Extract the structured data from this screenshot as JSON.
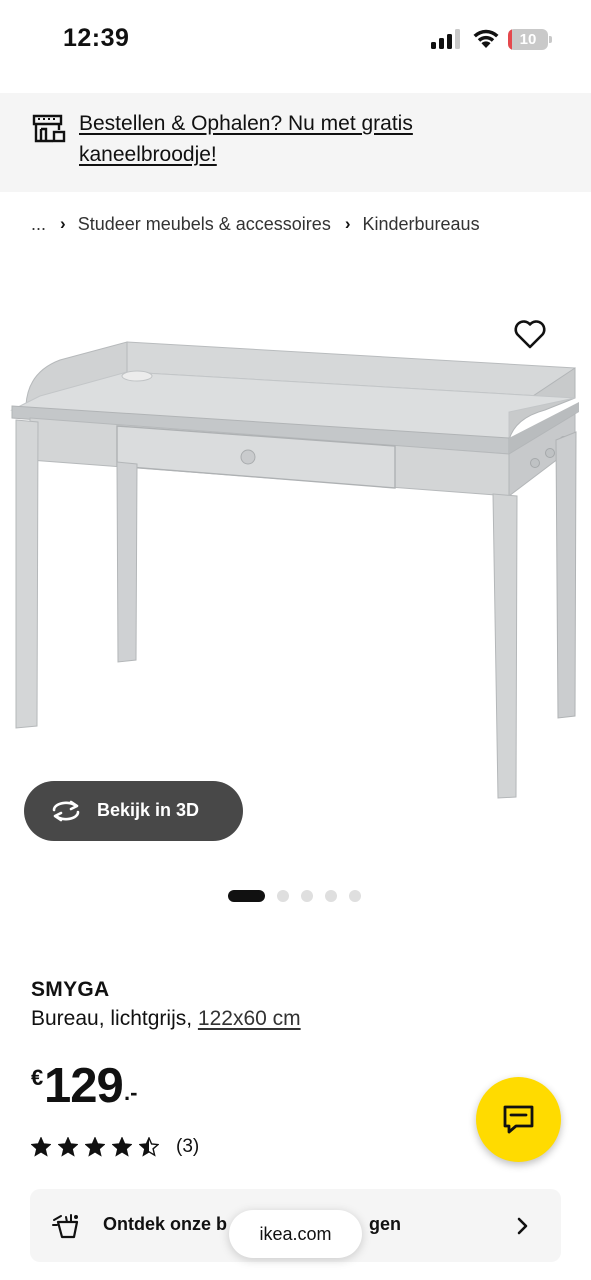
{
  "status_bar": {
    "time": "12:39",
    "battery_level": "10",
    "battery_fraction": 0.1,
    "icons": [
      "signal-icon",
      "wifi-icon",
      "battery-icon"
    ]
  },
  "promo_banner": {
    "icon": "store-icon",
    "text": "Bestellen & Ophalen? Nu met gratis kaneelbroodje!"
  },
  "breadcrumb": {
    "items": [
      "...",
      "Studeer meubels & accessoires",
      "Kinderbureaus"
    ]
  },
  "gallery": {
    "favorite_icon": "heart-icon",
    "view_3d_label": "Bekijk in 3D",
    "view_3d_icon": "rotate-icon",
    "image_count": 5,
    "active_index": 0
  },
  "product": {
    "name": "SMYGA",
    "description": "Bureau, lichtgrijs, ",
    "size": "122x60 cm",
    "price": {
      "currency": "€",
      "amount": "129",
      "suffix": ".-"
    },
    "rating": {
      "stars": 4.5,
      "max_stars": 5,
      "review_count": "(3)"
    }
  },
  "chat": {
    "icon": "chat-icon"
  },
  "discover": {
    "icon": "paint-bucket-icon",
    "label": "Ontdek onze betaaloplossingen",
    "visible_label_start": "Ontdek onze b",
    "visible_label_end": "gen",
    "chevron": "chevron-right-icon"
  },
  "browser": {
    "url": "ikea.com"
  },
  "colors": {
    "accent_yellow": "#ffdb00",
    "banner_bg": "#f5f5f5",
    "button_dark": "#484848",
    "battery_red": "#e5484d"
  }
}
